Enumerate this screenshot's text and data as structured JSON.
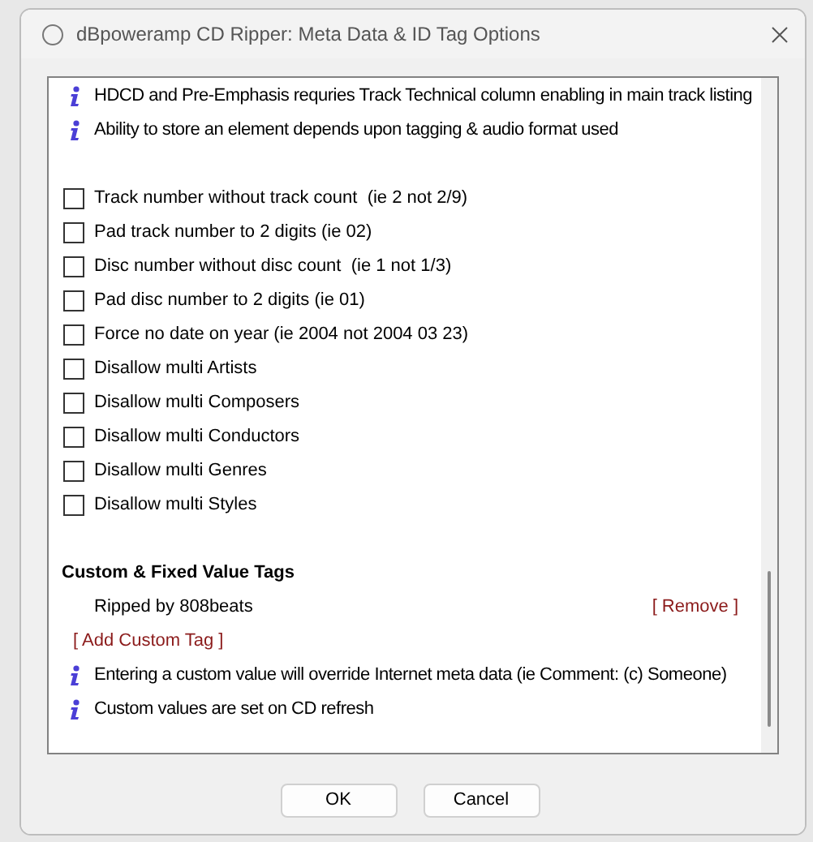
{
  "window": {
    "title": "dBpoweramp CD Ripper: Meta Data & ID Tag Options"
  },
  "top_notes": [
    "HDCD and Pre-Emphasis requries Track Technical column enabling in main track listing",
    "Ability to store an element depends upon tagging & audio format used"
  ],
  "options": [
    {
      "label": "Track number without track count  (ie 2 not 2/9)",
      "checked": false
    },
    {
      "label": "Pad track number to 2 digits (ie 02)",
      "checked": false
    },
    {
      "label": "Disc number without disc count  (ie 1 not 1/3)",
      "checked": false
    },
    {
      "label": "Pad disc number to 2 digits (ie 01)",
      "checked": false
    },
    {
      "label": "Force no date on year (ie 2004 not 2004 03 23)",
      "checked": false
    },
    {
      "label": "Disallow multi Artists",
      "checked": false
    },
    {
      "label": "Disallow multi Composers",
      "checked": false
    },
    {
      "label": "Disallow multi Conductors",
      "checked": false
    },
    {
      "label": "Disallow multi Genres",
      "checked": false
    },
    {
      "label": "Disallow multi Styles",
      "checked": false
    }
  ],
  "custom_section": {
    "heading": "Custom & Fixed Value Tags",
    "tags": [
      {
        "value": "Ripped by 808beats",
        "remove": "[ Remove ]"
      }
    ],
    "add_link": "[ Add Custom Tag ]",
    "notes": [
      "Entering a custom value will override Internet meta data (ie Comment: (c) Someone)",
      "Custom values are set on CD refresh"
    ]
  },
  "buttons": [
    "OK",
    "Cancel"
  ]
}
